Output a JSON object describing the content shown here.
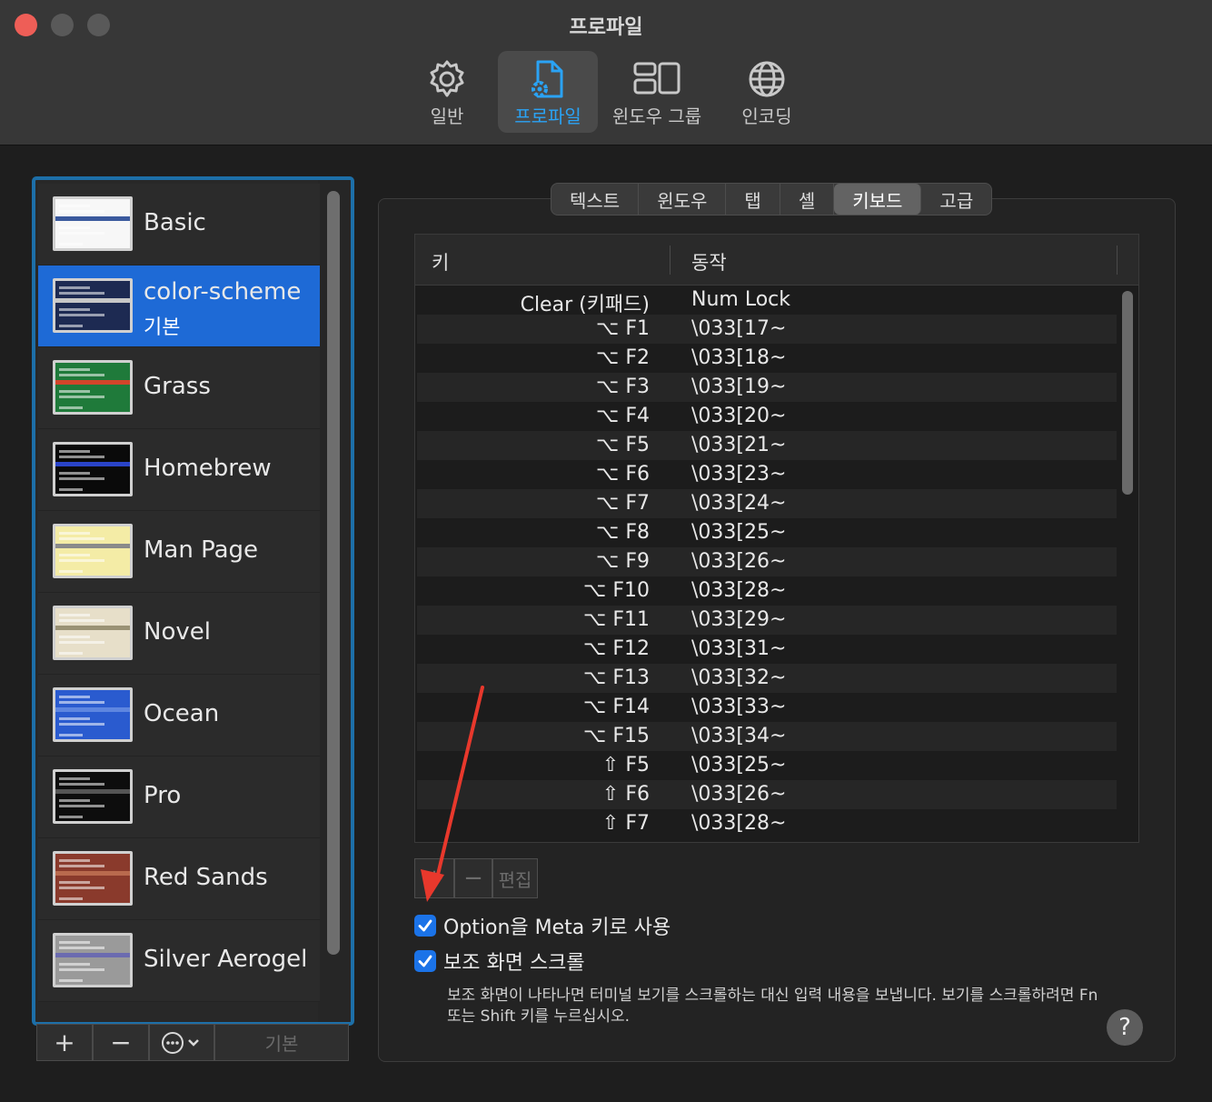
{
  "window": {
    "title": "프로파일"
  },
  "toolbar": {
    "items": [
      {
        "label": "일반",
        "icon": "gear-icon"
      },
      {
        "label": "프로파일",
        "icon": "profile-icon",
        "selected": true
      },
      {
        "label": "윈도우 그룹",
        "icon": "window-group-icon"
      },
      {
        "label": "인코딩",
        "icon": "globe-icon"
      }
    ]
  },
  "profiles": [
    {
      "name": "Basic",
      "theme": {
        "bg": "#f7f7f7",
        "hl": "#3b5a9e"
      }
    },
    {
      "name": "color-scheme",
      "subtitle": "기본",
      "selected": true,
      "theme": {
        "bg": "#1d2a52",
        "hl": "#c7c7c7"
      }
    },
    {
      "name": "Grass",
      "theme": {
        "bg": "#1f7a3a",
        "hl": "#d2452a"
      }
    },
    {
      "name": "Homebrew",
      "theme": {
        "bg": "#0a0a0a",
        "hl": "#2a44c8"
      }
    },
    {
      "name": "Man Page",
      "theme": {
        "bg": "#f4eca6",
        "hl": "#8a8a8a"
      }
    },
    {
      "name": "Novel",
      "theme": {
        "bg": "#e7dfc9",
        "hl": "#9a9275"
      }
    },
    {
      "name": "Ocean",
      "theme": {
        "bg": "#2a5bcf",
        "hl": "#5e86e0"
      }
    },
    {
      "name": "Pro",
      "theme": {
        "bg": "#0d0d0d",
        "hl": "#555555"
      }
    },
    {
      "name": "Red Sands",
      "theme": {
        "bg": "#8a3a2c",
        "hl": "#b96a4e"
      }
    },
    {
      "name": "Silver Aerogel",
      "theme": {
        "bg": "#9a9a9a",
        "hl": "#6b6bb0"
      }
    }
  ],
  "list_buttons": {
    "add": "+",
    "remove": "−",
    "default": "기본"
  },
  "tabs": [
    "텍스트",
    "윈도우",
    "탭",
    "셸",
    "키보드",
    "고급"
  ],
  "active_tab": "키보드",
  "table": {
    "col_key": "키",
    "col_action": "동작",
    "rows": [
      {
        "key": "Clear (키패드)",
        "action": "Num Lock"
      },
      {
        "key": "⌥ F1",
        "action": "\\033[17~"
      },
      {
        "key": "⌥ F2",
        "action": "\\033[18~"
      },
      {
        "key": "⌥ F3",
        "action": "\\033[19~"
      },
      {
        "key": "⌥ F4",
        "action": "\\033[20~"
      },
      {
        "key": "⌥ F5",
        "action": "\\033[21~"
      },
      {
        "key": "⌥ F6",
        "action": "\\033[23~"
      },
      {
        "key": "⌥ F7",
        "action": "\\033[24~"
      },
      {
        "key": "⌥ F8",
        "action": "\\033[25~"
      },
      {
        "key": "⌥ F9",
        "action": "\\033[26~"
      },
      {
        "key": "⌥ F10",
        "action": "\\033[28~"
      },
      {
        "key": "⌥ F11",
        "action": "\\033[29~"
      },
      {
        "key": "⌥ F12",
        "action": "\\033[31~"
      },
      {
        "key": "⌥ F13",
        "action": "\\033[32~"
      },
      {
        "key": "⌥ F14",
        "action": "\\033[33~"
      },
      {
        "key": "⌥ F15",
        "action": "\\033[34~"
      },
      {
        "key": "⇧ F5",
        "action": "\\033[25~"
      },
      {
        "key": "⇧ F6",
        "action": "\\033[26~"
      },
      {
        "key": "⇧ F7",
        "action": "\\033[28~"
      }
    ]
  },
  "table_buttons": {
    "add": "+",
    "remove": "−",
    "edit": "편집"
  },
  "options": {
    "meta_key": {
      "label": "Option을 Meta 키로 사용",
      "checked": true
    },
    "alt_scroll": {
      "label": "보조 화면 스크롤",
      "checked": true
    },
    "alt_scroll_desc": "보조 화면이 나타나면 터미널 보기를 스크롤하는 대신 입력 내용을 보냅니다. 보기를 스크롤하려면 Fn 또는 Shift 키를 누르십시오."
  },
  "help": "?",
  "colors": {
    "accent": "#2aa3f5",
    "selection": "#1e6ad6",
    "annotation_arrow": "#e8382c"
  }
}
